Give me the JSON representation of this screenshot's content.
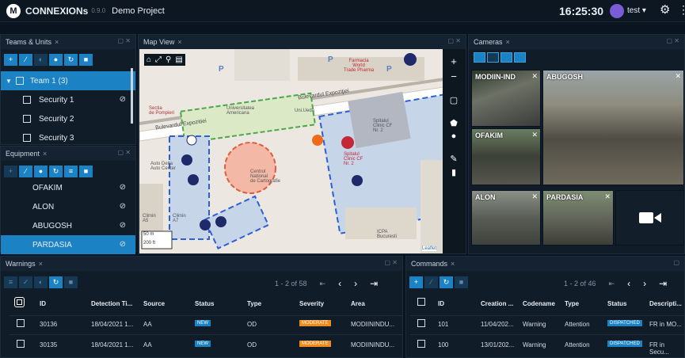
{
  "app": {
    "brand": "CONNEXIONs",
    "version": "0.9.0",
    "project": "Demo Project",
    "clock": "16:25:30",
    "user": "test ▾",
    "gear_icon": "⚙",
    "kebab_icon": "⋮",
    "logo_glyph": "M"
  },
  "teams": {
    "title": "Teams & Units",
    "close": "×",
    "items": [
      {
        "label": "Team 1 (3)",
        "selected": true
      },
      {
        "label": "Security 1"
      },
      {
        "label": "Security 2"
      },
      {
        "label": "Security 3"
      }
    ],
    "toolbar": [
      "+",
      "∕",
      "◐",
      "●",
      "↻",
      "■"
    ]
  },
  "equipment": {
    "title": "Equipment",
    "close": "×",
    "items": [
      {
        "label": "OFAKIM"
      },
      {
        "label": "ALON"
      },
      {
        "label": "ABUGOSH"
      },
      {
        "label": "PARDASIA",
        "selected": true
      }
    ]
  },
  "map": {
    "title": "Map View",
    "close": "×",
    "labels": {
      "farmacia": "Farmacia\nWorld\nTrade Pharma",
      "bulevardul1": "Bulevardul Expoziţiei",
      "bulevardul2": "Bulevardul Expozitiei",
      "universitatea": "Universitatea\nAmericana",
      "sectia": "Sectia\nde Pompieri",
      "spitalul": "Spitalul\nClinic CF\nNr. 2",
      "spitalul2": "Spitalul\nClinic CF\nNr. 2",
      "centrul": "Centrul\nNational\nde Cartografie",
      "auto": "Auto Delta\nAuto Center",
      "climin": "Climin\nA5",
      "climin2": "Climin\nA7",
      "icpa": "ICPA\nBucuresti",
      "scale1": "50 m",
      "scale2": "200 ft",
      "leaflet": "Leaflet",
      "p1": "P",
      "p2": "P",
      "p3": "P",
      "unirea": "Uni.Ueda"
    }
  },
  "cameras": {
    "title": "Cameras",
    "close": "×",
    "feeds": [
      {
        "label": "MODIIN-IND"
      },
      {
        "label": "ABUGOSH"
      },
      {
        "label": "OFAKIM"
      },
      {
        "label": "ALON"
      },
      {
        "label": "PARDASIA"
      }
    ]
  },
  "warnings": {
    "title": "Warnings",
    "close": "×",
    "pager": "1 - 2 of 58",
    "columns": [
      "ID",
      "Detection Ti...",
      "Source",
      "Status",
      "Type",
      "Severity",
      "Area"
    ],
    "rows": [
      [
        "30136",
        "18/04/2021 1...",
        "AA",
        "NEW",
        "OD",
        "MODERATE",
        "MODIININDU..."
      ],
      [
        "30135",
        "18/04/2021 1...",
        "AA",
        "NEW",
        "OD",
        "MODERATE",
        "MODIININDU..."
      ]
    ]
  },
  "commands": {
    "title": "Commands",
    "close": "×",
    "pager": "1 - 2 of 46",
    "columns": [
      "ID",
      "Creation ...",
      "Codename",
      "Type",
      "Status",
      "Descripti..."
    ],
    "rows": [
      [
        "101",
        "11/04/202...",
        "Warning",
        "Attention",
        "DISPATCHED",
        "FR in MO..."
      ],
      [
        "100",
        "13/01/202...",
        "Warning",
        "Attention",
        "DISPATCHED",
        "FR in Secu..."
      ]
    ]
  },
  "colors": {
    "accent": "#1b83c4",
    "new_badge": "#1b83c4",
    "moderate_badge": "#f08a1c",
    "dispatched_badge": "#1b83c4"
  }
}
